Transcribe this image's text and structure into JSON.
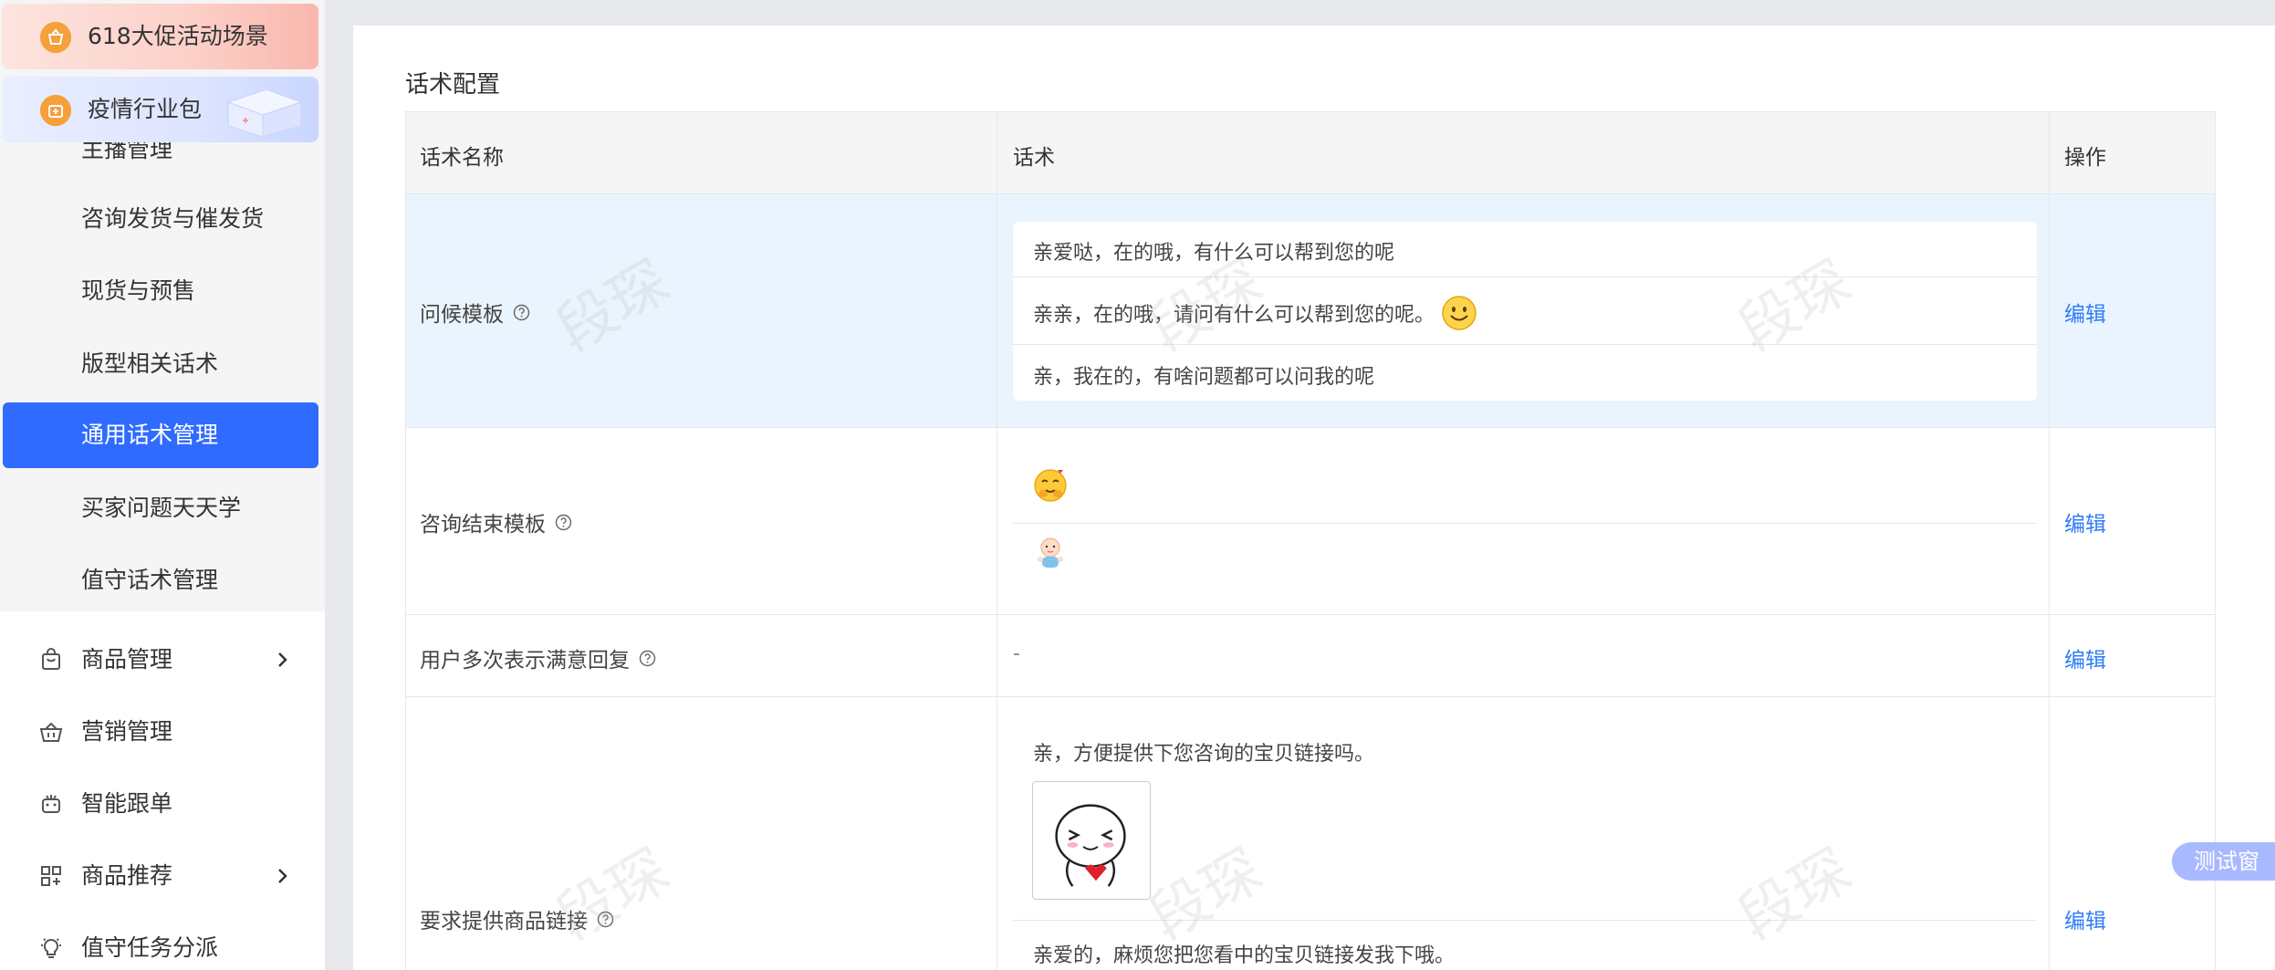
{
  "sidebar": {
    "promos": [
      {
        "label": "618大促活动场景"
      },
      {
        "label": "疫情行业包"
      }
    ],
    "sub_items": [
      {
        "label": "主播管理"
      },
      {
        "label": "咨询发货与催发货"
      },
      {
        "label": "现货与预售"
      },
      {
        "label": "版型相关话术"
      },
      {
        "label": "通用话术管理"
      },
      {
        "label": "买家问题天天学"
      },
      {
        "label": "值守话术管理"
      }
    ],
    "menu_items": [
      {
        "label": "商品管理",
        "icon": "bag-icon",
        "has_arrow": true
      },
      {
        "label": "营销管理",
        "icon": "basket-icon",
        "has_arrow": false
      },
      {
        "label": "智能跟单",
        "icon": "robot-icon",
        "has_arrow": false
      },
      {
        "label": "商品推荐",
        "icon": "grid-icon",
        "has_arrow": true
      },
      {
        "label": "值守任务分派",
        "icon": "bulb-icon",
        "has_arrow": false
      }
    ],
    "active_item": "通用话术管理"
  },
  "main": {
    "section_title": "话术配置",
    "columns": {
      "name": "话术名称",
      "script": "话术",
      "action": "操作"
    },
    "rows": [
      {
        "name": "问候模板",
        "scripts": [
          "亲爱哒，在的哦，有什么可以帮到您的呢",
          "亲亲，在的哦，请问有什么可以帮到您的呢。",
          "亲，我在的，有啥问题都可以问我的呢"
        ],
        "action": "编辑"
      },
      {
        "name": "咨询结束模板",
        "scripts": [
          "hug-emoji",
          "baby-emoji"
        ],
        "action": "编辑"
      },
      {
        "name": "用户多次表示满意回复",
        "scripts": [
          "-"
        ],
        "action": "编辑"
      },
      {
        "name": "要求提供商品链接",
        "scripts": [
          "亲，方便提供下您咨询的宝贝链接吗。",
          "亲爱的，麻烦您把您看中的宝贝链接发我下哦。"
        ],
        "action": "编辑"
      }
    ]
  },
  "watermark": "段琛",
  "test_window": "测试窗",
  "colors": {
    "accent": "#2f6bff",
    "link": "#2f7cf6",
    "highlight_row": "#eaf4fe"
  }
}
